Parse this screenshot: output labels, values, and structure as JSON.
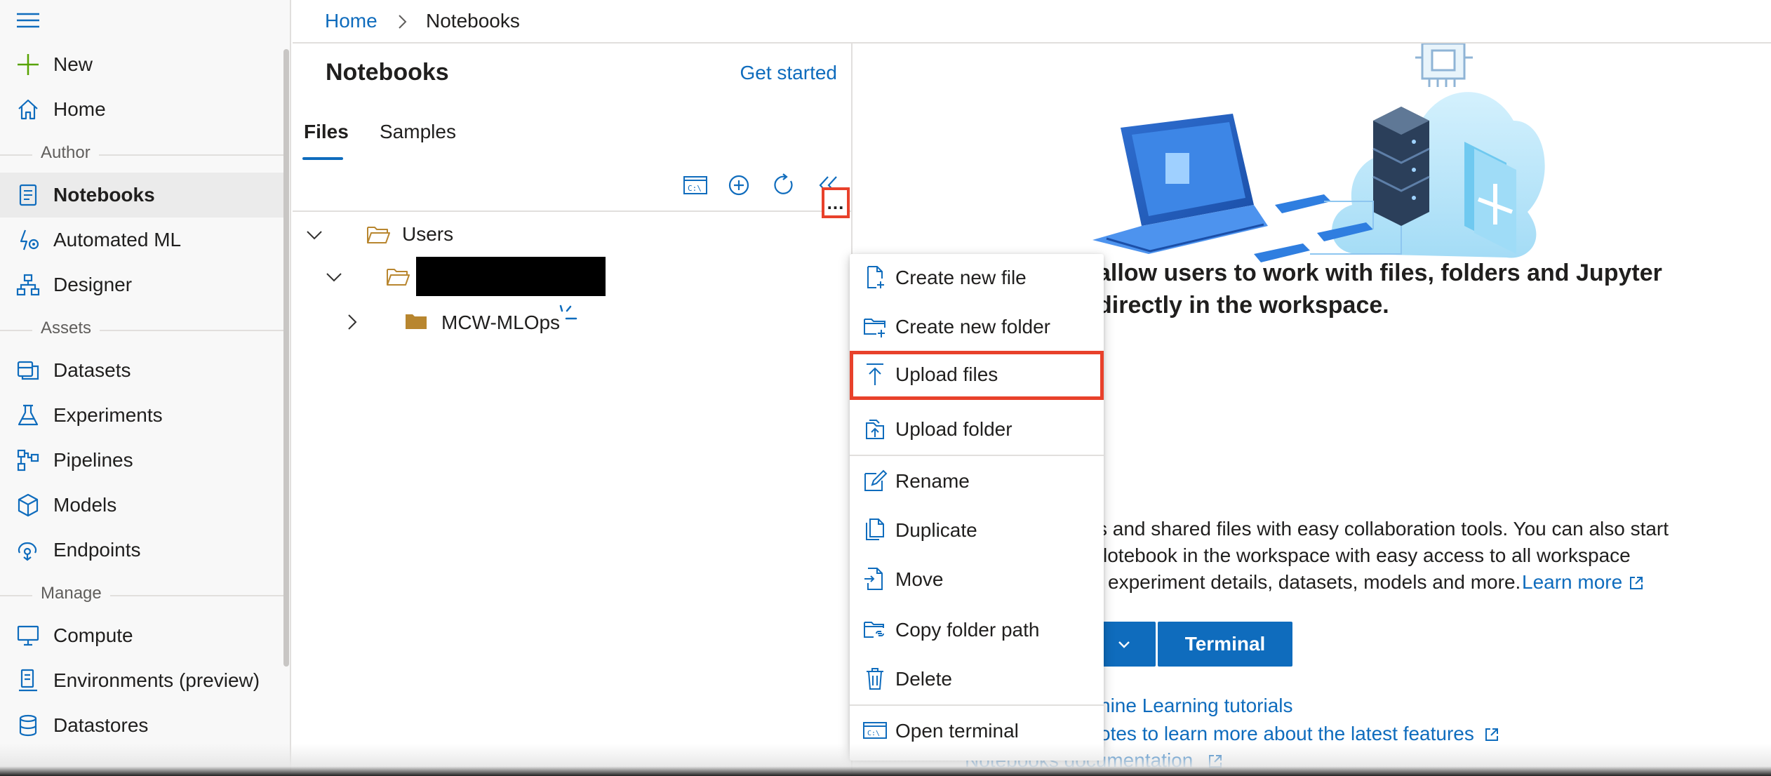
{
  "sidebar": {
    "items_top": [
      {
        "label": "New",
        "icon": "plus-icon"
      },
      {
        "label": "Home",
        "icon": "home-icon"
      }
    ],
    "sections": [
      {
        "title": "Author",
        "items": [
          {
            "label": "Notebooks",
            "icon": "notebook-icon",
            "selected": true
          },
          {
            "label": "Automated ML",
            "icon": "automl-icon"
          },
          {
            "label": "Designer",
            "icon": "designer-icon"
          }
        ]
      },
      {
        "title": "Assets",
        "items": [
          {
            "label": "Datasets",
            "icon": "dataset-icon"
          },
          {
            "label": "Experiments",
            "icon": "flask-icon"
          },
          {
            "label": "Pipelines",
            "icon": "pipeline-icon"
          },
          {
            "label": "Models",
            "icon": "cube-icon"
          },
          {
            "label": "Endpoints",
            "icon": "endpoint-icon"
          }
        ]
      },
      {
        "title": "Manage",
        "items": [
          {
            "label": "Compute",
            "icon": "monitor-icon"
          },
          {
            "label": "Environments (preview)",
            "icon": "environment-icon"
          },
          {
            "label": "Datastores",
            "icon": "database-icon"
          }
        ]
      }
    ]
  },
  "breadcrumb": {
    "home": "Home",
    "current": "Notebooks"
  },
  "panel": {
    "title": "Notebooks",
    "get_started": "Get started",
    "tabs": [
      "Files",
      "Samples"
    ],
    "toolbar_icons": [
      "terminal-icon",
      "add-circle-icon",
      "refresh-icon",
      "collapse-icon"
    ],
    "tree": {
      "root": "Users",
      "folder": "MCW-MLOps",
      "more_label": "..."
    }
  },
  "context_menu": {
    "items": [
      {
        "label": "Create new file",
        "icon": "new-file-icon"
      },
      {
        "label": "Create new folder",
        "icon": "new-folder-icon"
      },
      {
        "label": "Upload files",
        "icon": "upload-icon",
        "highlighted": true
      },
      {
        "label": "Upload folder",
        "icon": "upload-folder-icon"
      },
      {
        "label": "Rename",
        "icon": "rename-icon"
      },
      {
        "label": "Duplicate",
        "icon": "duplicate-icon"
      },
      {
        "label": "Move",
        "icon": "move-icon"
      },
      {
        "label": "Copy folder path",
        "icon": "copy-path-icon"
      },
      {
        "label": "Delete",
        "icon": "trash-icon"
      },
      {
        "label": "Open terminal",
        "icon": "terminal-icon"
      }
    ]
  },
  "welcome": {
    "heading_line1": "allow users to work with files, folders and Jupyter",
    "heading_line2": "directly in the workspace.",
    "body_line1": "s and shared files with easy collaboration tools. You can also start",
    "body_line2": "lotebook in the workspace with easy access to all workspace",
    "body_line3": "experiment details, datasets, models and more.",
    "learn_more": "Learn more",
    "terminal_button": "Terminal",
    "link_tutorials": "hine Learning tutorials",
    "link_notes": "otes to learn more about the latest features",
    "link_docs": "Notebooks documentation"
  },
  "colors": {
    "accent": "#0f6cbd",
    "highlight_border": "#e8412b",
    "folder": "#b8862f"
  }
}
